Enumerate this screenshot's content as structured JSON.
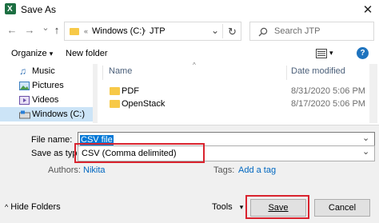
{
  "window": {
    "title": "Save As",
    "app_icon": "excel-icon",
    "app_icon_letter": "X",
    "close_glyph": "✕"
  },
  "navigation": {
    "back_glyph": "←",
    "forward_glyph": "→",
    "recent_glyph": "⌄",
    "up_glyph": "↑"
  },
  "address": {
    "separator": "«",
    "segments": [
      "Windows (C:)",
      "JTP"
    ],
    "segment_separator": "›",
    "dropdown_glyph": "⌄",
    "refresh_glyph": "↻"
  },
  "search": {
    "placeholder": "Search JTP",
    "icon": "search-icon"
  },
  "toolbar": {
    "organize_label": "Organize",
    "organize_arrow": "▾",
    "new_folder_label": "New folder",
    "view_arrow": "▾",
    "help_glyph": "?"
  },
  "navpane": {
    "items": [
      {
        "label": "Music",
        "icon": "music-icon"
      },
      {
        "label": "Pictures",
        "icon": "pictures-icon"
      },
      {
        "label": "Videos",
        "icon": "videos-icon"
      },
      {
        "label": "Windows (C:)",
        "icon": "drive-icon",
        "selected": true
      }
    ]
  },
  "filelist": {
    "columns": [
      "Name",
      "Date modified"
    ],
    "sort_indicator": "^",
    "rows": [
      {
        "name": "PDF",
        "date": "8/31/2020 5:06 PM"
      },
      {
        "name": "OpenStack",
        "date": "8/17/2020 5:06 PM"
      }
    ]
  },
  "form": {
    "file_name_label": "File name:",
    "file_name_value": "CSV file",
    "save_as_type_label": "Save as type:",
    "save_as_type_value": "CSV (Comma delimited)",
    "authors_label": "Authors:",
    "authors_value": "Nikita",
    "tags_label": "Tags:",
    "tags_value": "Add a tag",
    "dropdown_glyph": "⌄"
  },
  "footer": {
    "hide_folders_glyph": "^",
    "hide_folders_label": "Hide Folders",
    "tools_label": "Tools",
    "tools_arrow": "▾",
    "save_label": "Save",
    "cancel_label": "Cancel"
  },
  "colors": {
    "highlight_outline": "#d9232e",
    "selection": "#cce4f7",
    "link": "#0067c0",
    "folder": "#f7c948"
  }
}
